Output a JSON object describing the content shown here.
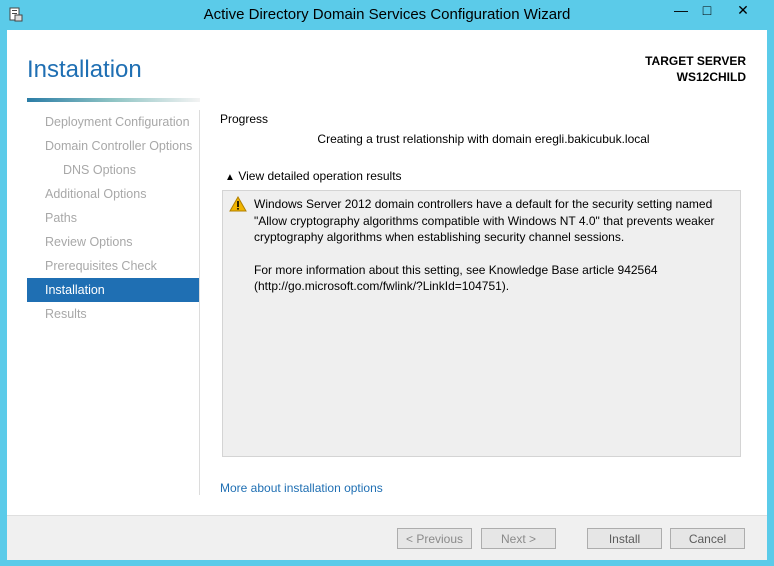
{
  "window": {
    "title": "Active Directory Domain Services Configuration Wizard",
    "minimize": "—",
    "maximize": "□",
    "close": "✕"
  },
  "header": {
    "page_title": "Installation",
    "target_label": "TARGET SERVER",
    "target_name": "WS12CHILD"
  },
  "nav": {
    "items": [
      {
        "label": "Deployment Configuration"
      },
      {
        "label": "Domain Controller Options"
      },
      {
        "label": "DNS Options"
      },
      {
        "label": "Additional Options"
      },
      {
        "label": "Paths"
      },
      {
        "label": "Review Options"
      },
      {
        "label": "Prerequisites Check"
      },
      {
        "label": "Installation"
      },
      {
        "label": "Results"
      }
    ]
  },
  "main": {
    "progress_label": "Progress",
    "status": "Creating a trust relationship with domain eregli.bakicubuk.local",
    "details_toggle": "View detailed operation results",
    "caret": "▲",
    "result_paragraph1": "Windows Server 2012 domain controllers have a default for the security setting named \"Allow cryptography algorithms compatible with Windows NT 4.0\" that prevents weaker cryptography algorithms when establishing security channel sessions.",
    "result_paragraph2": "For more information about this setting, see Knowledge Base article 942564 (http://go.microsoft.com/fwlink/?LinkId=104751).",
    "more_link": "More about installation options"
  },
  "footer": {
    "previous": "< Previous",
    "next": "Next >",
    "install": "Install",
    "cancel": "Cancel"
  },
  "colors": {
    "accent": "#1f6fb3",
    "window_frame": "#5bcbe9",
    "warning": "#f0b400"
  },
  "icons": {
    "app": "server-manager-icon",
    "warning": "warning-icon"
  }
}
